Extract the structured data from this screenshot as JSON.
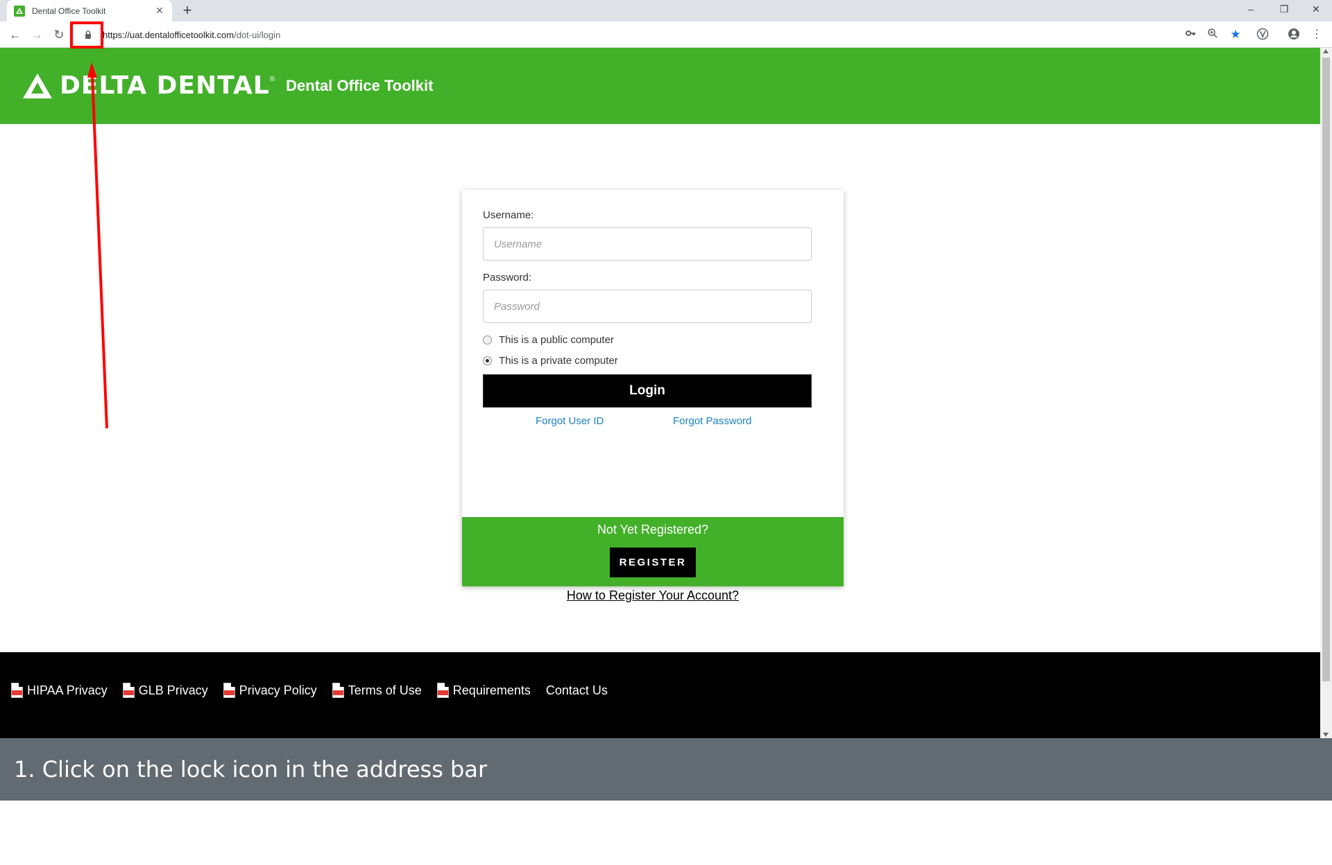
{
  "browser": {
    "tab_title": "Dental Office Toolkit",
    "url_host": "https://uat.dentalofficetoolkit.com",
    "url_path": "/dot-ui/login"
  },
  "header": {
    "logo_text": "DELTA DENTAL",
    "logo_reg": "®",
    "subtitle": "Dental Office Toolkit",
    "brand_color": "#43b02a"
  },
  "login": {
    "username_label": "Username:",
    "username_placeholder": "Username",
    "password_label": "Password:",
    "password_placeholder": "Password",
    "public_label": "This is a public computer",
    "private_label": "This is a private computer",
    "selected_option": "private",
    "login_button": "Login",
    "forgot_user_id": "Forgot User ID",
    "forgot_password": "Forgot Password"
  },
  "register": {
    "title": "Not Yet Registered?",
    "button": "REGISTER",
    "how_to": "How to Register Your Account?"
  },
  "footer": {
    "links": [
      {
        "label": "HIPAA Privacy",
        "icon": "pdf-icon"
      },
      {
        "label": "GLB Privacy",
        "icon": "pdf-icon"
      },
      {
        "label": "Privacy Policy",
        "icon": "pdf-icon"
      },
      {
        "label": "Terms of Use",
        "icon": "pdf-icon"
      },
      {
        "label": "Requirements",
        "icon": "pdf-icon"
      },
      {
        "label": "Contact Us",
        "icon": ""
      }
    ]
  },
  "caption": {
    "text": "1. Click on the lock icon in the address bar"
  }
}
